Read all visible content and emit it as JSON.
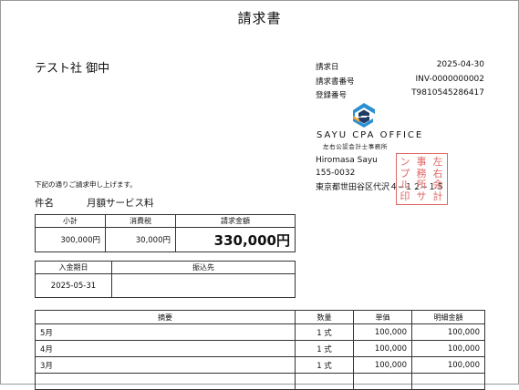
{
  "document": {
    "title": "請求書"
  },
  "customer": {
    "name": "テスト社 御中"
  },
  "meta": [
    {
      "label": "請求日",
      "value": "2025-04-30"
    },
    {
      "label": "請求書番号",
      "value": "INV-0000000002"
    },
    {
      "label": "登録番号",
      "value": "T9810545286417"
    }
  ],
  "issuer": {
    "logo_icon": "sayu-cpa-logo-icon",
    "logo_colors": {
      "blue": "#2b8fd0",
      "orange": "#f2a533",
      "navy": "#1f3c66"
    },
    "office_name": "SAYU CPA OFFICE",
    "office_name_jp": "左右公認会計士事務所",
    "person": "Hiromasa Sayu",
    "postal": "155-0032",
    "address": "東京都世田谷区代沢４−１２−１５"
  },
  "seal": {
    "color": "#e06565",
    "columns": [
      "左右会計",
      "事務所サ",
      "ンプル印"
    ]
  },
  "note": "下記の通りご請求申し上げます。",
  "subject": {
    "label": "件名",
    "value": "月額サービス料"
  },
  "summary": {
    "headers": [
      "小計",
      "消費税",
      "請求金額"
    ],
    "subtotal": "300,000円",
    "tax": "30,000円",
    "total": "330,000円"
  },
  "payment": {
    "headers": [
      "入金期日",
      "振込先"
    ],
    "due_date": "2025-05-31",
    "bank": ""
  },
  "items": {
    "headers": [
      "摘要",
      "数量",
      "単価",
      "明細金額"
    ],
    "rows": [
      {
        "desc": "5月",
        "qty": "1 式",
        "price": "100,000",
        "amount": "100,000"
      },
      {
        "desc": "4月",
        "qty": "1 式",
        "price": "100,000",
        "amount": "100,000"
      },
      {
        "desc": "3月",
        "qty": "1 式",
        "price": "100,000",
        "amount": "100,000"
      }
    ]
  }
}
